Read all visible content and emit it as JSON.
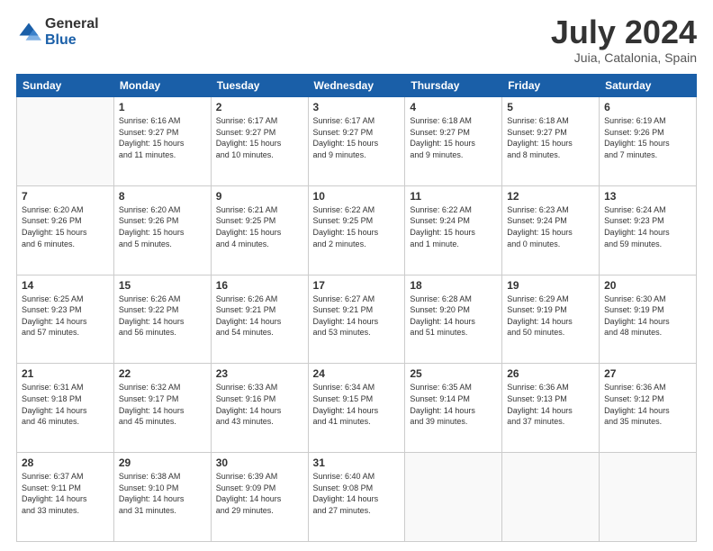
{
  "header": {
    "logo_general": "General",
    "logo_blue": "Blue",
    "month_title": "July 2024",
    "location": "Juia, Catalonia, Spain"
  },
  "days_of_week": [
    "Sunday",
    "Monday",
    "Tuesday",
    "Wednesday",
    "Thursday",
    "Friday",
    "Saturday"
  ],
  "weeks": [
    [
      {
        "day": "",
        "info": ""
      },
      {
        "day": "1",
        "info": "Sunrise: 6:16 AM\nSunset: 9:27 PM\nDaylight: 15 hours\nand 11 minutes."
      },
      {
        "day": "2",
        "info": "Sunrise: 6:17 AM\nSunset: 9:27 PM\nDaylight: 15 hours\nand 10 minutes."
      },
      {
        "day": "3",
        "info": "Sunrise: 6:17 AM\nSunset: 9:27 PM\nDaylight: 15 hours\nand 9 minutes."
      },
      {
        "day": "4",
        "info": "Sunrise: 6:18 AM\nSunset: 9:27 PM\nDaylight: 15 hours\nand 9 minutes."
      },
      {
        "day": "5",
        "info": "Sunrise: 6:18 AM\nSunset: 9:27 PM\nDaylight: 15 hours\nand 8 minutes."
      },
      {
        "day": "6",
        "info": "Sunrise: 6:19 AM\nSunset: 9:26 PM\nDaylight: 15 hours\nand 7 minutes."
      }
    ],
    [
      {
        "day": "7",
        "info": "Sunrise: 6:20 AM\nSunset: 9:26 PM\nDaylight: 15 hours\nand 6 minutes."
      },
      {
        "day": "8",
        "info": "Sunrise: 6:20 AM\nSunset: 9:26 PM\nDaylight: 15 hours\nand 5 minutes."
      },
      {
        "day": "9",
        "info": "Sunrise: 6:21 AM\nSunset: 9:25 PM\nDaylight: 15 hours\nand 4 minutes."
      },
      {
        "day": "10",
        "info": "Sunrise: 6:22 AM\nSunset: 9:25 PM\nDaylight: 15 hours\nand 2 minutes."
      },
      {
        "day": "11",
        "info": "Sunrise: 6:22 AM\nSunset: 9:24 PM\nDaylight: 15 hours\nand 1 minute."
      },
      {
        "day": "12",
        "info": "Sunrise: 6:23 AM\nSunset: 9:24 PM\nDaylight: 15 hours\nand 0 minutes."
      },
      {
        "day": "13",
        "info": "Sunrise: 6:24 AM\nSunset: 9:23 PM\nDaylight: 14 hours\nand 59 minutes."
      }
    ],
    [
      {
        "day": "14",
        "info": "Sunrise: 6:25 AM\nSunset: 9:23 PM\nDaylight: 14 hours\nand 57 minutes."
      },
      {
        "day": "15",
        "info": "Sunrise: 6:26 AM\nSunset: 9:22 PM\nDaylight: 14 hours\nand 56 minutes."
      },
      {
        "day": "16",
        "info": "Sunrise: 6:26 AM\nSunset: 9:21 PM\nDaylight: 14 hours\nand 54 minutes."
      },
      {
        "day": "17",
        "info": "Sunrise: 6:27 AM\nSunset: 9:21 PM\nDaylight: 14 hours\nand 53 minutes."
      },
      {
        "day": "18",
        "info": "Sunrise: 6:28 AM\nSunset: 9:20 PM\nDaylight: 14 hours\nand 51 minutes."
      },
      {
        "day": "19",
        "info": "Sunrise: 6:29 AM\nSunset: 9:19 PM\nDaylight: 14 hours\nand 50 minutes."
      },
      {
        "day": "20",
        "info": "Sunrise: 6:30 AM\nSunset: 9:19 PM\nDaylight: 14 hours\nand 48 minutes."
      }
    ],
    [
      {
        "day": "21",
        "info": "Sunrise: 6:31 AM\nSunset: 9:18 PM\nDaylight: 14 hours\nand 46 minutes."
      },
      {
        "day": "22",
        "info": "Sunrise: 6:32 AM\nSunset: 9:17 PM\nDaylight: 14 hours\nand 45 minutes."
      },
      {
        "day": "23",
        "info": "Sunrise: 6:33 AM\nSunset: 9:16 PM\nDaylight: 14 hours\nand 43 minutes."
      },
      {
        "day": "24",
        "info": "Sunrise: 6:34 AM\nSunset: 9:15 PM\nDaylight: 14 hours\nand 41 minutes."
      },
      {
        "day": "25",
        "info": "Sunrise: 6:35 AM\nSunset: 9:14 PM\nDaylight: 14 hours\nand 39 minutes."
      },
      {
        "day": "26",
        "info": "Sunrise: 6:36 AM\nSunset: 9:13 PM\nDaylight: 14 hours\nand 37 minutes."
      },
      {
        "day": "27",
        "info": "Sunrise: 6:36 AM\nSunset: 9:12 PM\nDaylight: 14 hours\nand 35 minutes."
      }
    ],
    [
      {
        "day": "28",
        "info": "Sunrise: 6:37 AM\nSunset: 9:11 PM\nDaylight: 14 hours\nand 33 minutes."
      },
      {
        "day": "29",
        "info": "Sunrise: 6:38 AM\nSunset: 9:10 PM\nDaylight: 14 hours\nand 31 minutes."
      },
      {
        "day": "30",
        "info": "Sunrise: 6:39 AM\nSunset: 9:09 PM\nDaylight: 14 hours\nand 29 minutes."
      },
      {
        "day": "31",
        "info": "Sunrise: 6:40 AM\nSunset: 9:08 PM\nDaylight: 14 hours\nand 27 minutes."
      },
      {
        "day": "",
        "info": ""
      },
      {
        "day": "",
        "info": ""
      },
      {
        "day": "",
        "info": ""
      }
    ]
  ]
}
